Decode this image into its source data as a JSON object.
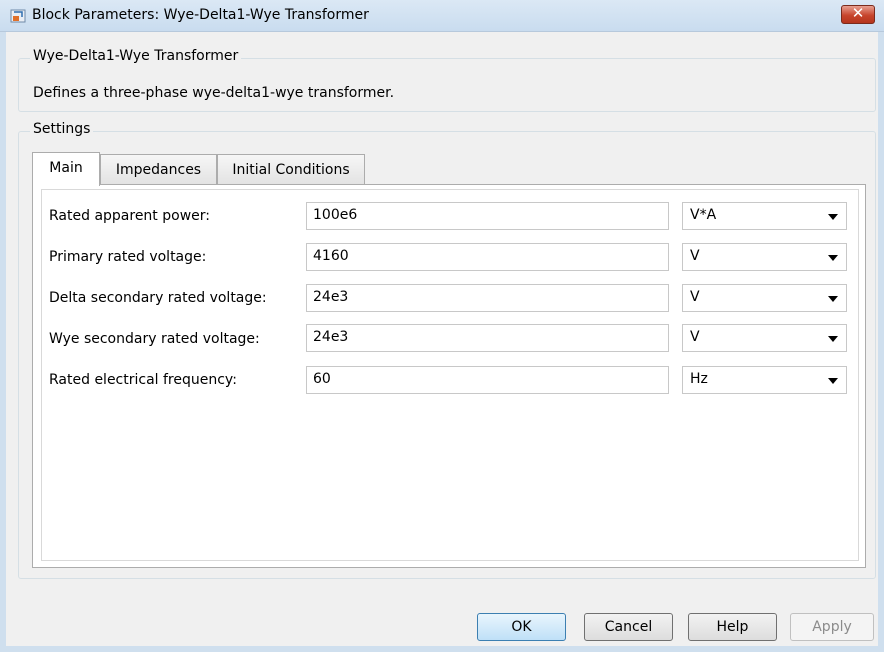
{
  "window": {
    "title": "Block Parameters: Wye-Delta1-Wye Transformer",
    "close_symbol": "✕"
  },
  "description_group": {
    "legend": "Wye-Delta1-Wye Transformer",
    "text": "Defines a three-phase wye-delta1-wye transformer."
  },
  "settings": {
    "legend": "Settings",
    "tabs": [
      {
        "label": "Main",
        "active": true
      },
      {
        "label": "Impedances",
        "active": false
      },
      {
        "label": "Initial Conditions",
        "active": false
      }
    ],
    "params": [
      {
        "label": "Rated apparent power:",
        "value": "100e6",
        "unit": "V*A"
      },
      {
        "label": "Primary rated voltage:",
        "value": "4160",
        "unit": "V"
      },
      {
        "label": "Delta secondary rated voltage:",
        "value": "24e3",
        "unit": "V"
      },
      {
        "label": "Wye secondary rated voltage:",
        "value": "24e3",
        "unit": "V"
      },
      {
        "label": "Rated electrical frequency:",
        "value": "60",
        "unit": "Hz"
      }
    ]
  },
  "buttons": {
    "ok": "OK",
    "cancel": "Cancel",
    "help": "Help",
    "apply": "Apply"
  },
  "icons": {
    "app": "simulink-block-icon",
    "close": "close-icon",
    "dropdown": "chevron-down-icon"
  },
  "colors": {
    "titlebar": "#c9dcef",
    "close_button": "#c7452d",
    "default_button": "#bfe0f7",
    "dialog_bg": "#f0f0f0"
  }
}
